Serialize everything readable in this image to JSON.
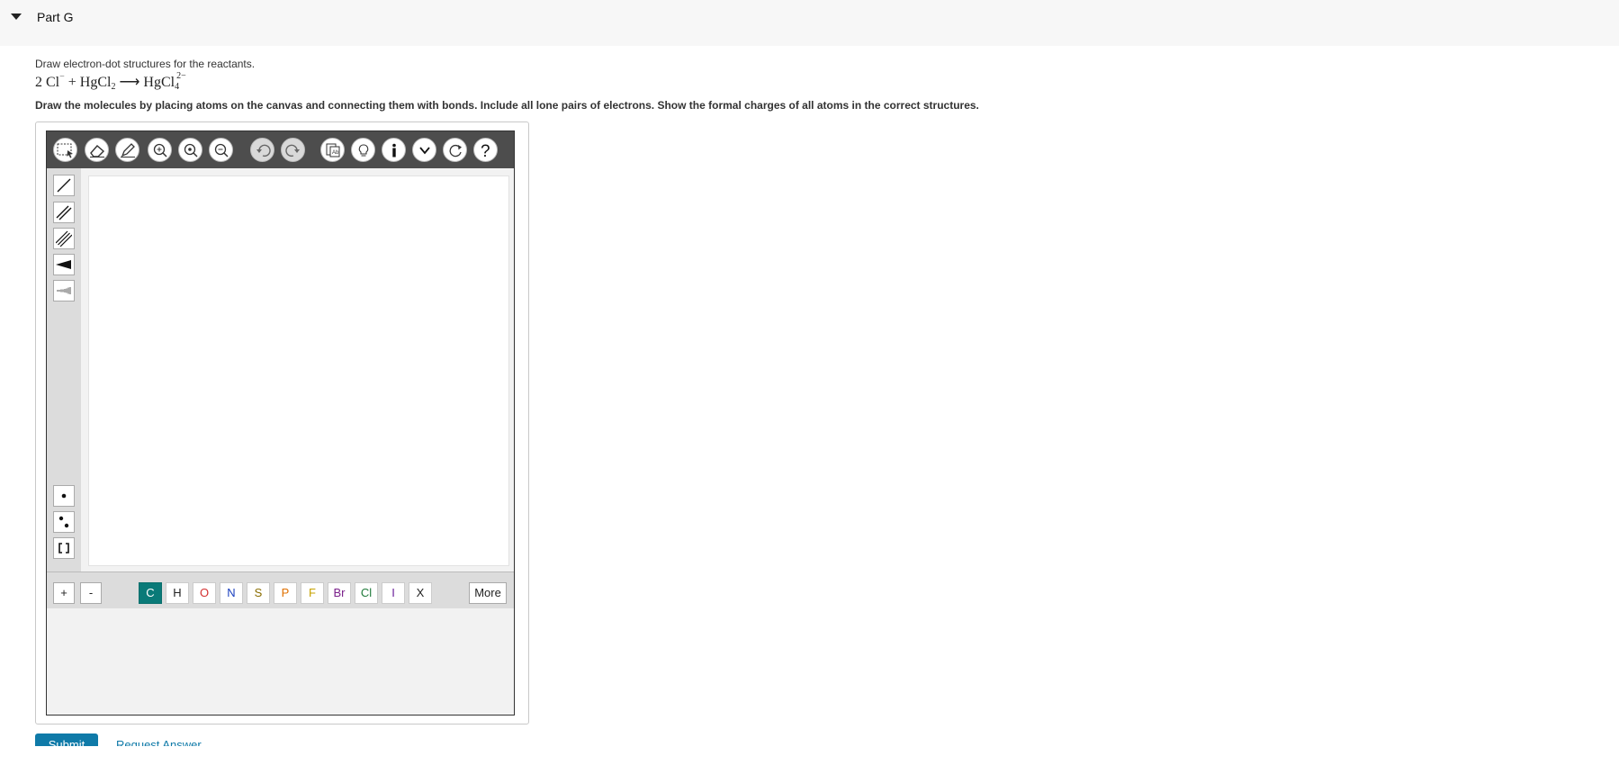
{
  "header": {
    "title": "Part G"
  },
  "question": {
    "prompt": "Draw electron-dot structures for the reactants.",
    "equation": {
      "coef": "2",
      "reactant1": "Cl",
      "reactant1_charge": "−",
      "plus": "+",
      "reactant2": "HgCl",
      "reactant2_sub": "2",
      "arrow": "⟶",
      "product": "HgCl",
      "product_sub": "4",
      "product_charge": "2−"
    },
    "instructions": "Draw the molecules by placing atoms on the canvas and connecting them with bonds. Include all lone pairs of electrons. Show the formal charges of all atoms in the correct structures."
  },
  "editor": {
    "toolbar": [
      "select-icon",
      "eraser-icon",
      "pencil-icon",
      "zoom-in-icon",
      "zoom-fit-icon",
      "zoom-out-icon",
      "undo-icon",
      "redo-icon",
      "template-icon",
      "lightbulb-icon",
      "info-icon",
      "chevron-down-icon",
      "reset-icon",
      "help-icon"
    ],
    "bond_tools": [
      "single-bond-icon",
      "double-bond-icon",
      "triple-bond-icon",
      "wedge-bond-icon",
      "hash-bond-icon"
    ],
    "electron_tools": [
      "single-electron-icon",
      "electron-pair-icon",
      "bracket-icon"
    ],
    "charges": {
      "plus": "+",
      "minus": "-"
    },
    "elements": [
      {
        "symbol": "C",
        "color": "#0a7a78",
        "active": true
      },
      {
        "symbol": "H",
        "color": "#222222",
        "active": false
      },
      {
        "symbol": "O",
        "color": "#d32f2f",
        "active": false
      },
      {
        "symbol": "N",
        "color": "#1a3fbf",
        "active": false
      },
      {
        "symbol": "S",
        "color": "#8a6d00",
        "active": false
      },
      {
        "symbol": "P",
        "color": "#e07000",
        "active": false
      },
      {
        "symbol": "F",
        "color": "#c7a200",
        "active": false
      },
      {
        "symbol": "Br",
        "color": "#7a1f8a",
        "active": false
      },
      {
        "symbol": "Cl",
        "color": "#1f7a3a",
        "active": false
      },
      {
        "symbol": "I",
        "color": "#6a1f9a",
        "active": false
      },
      {
        "symbol": "X",
        "color": "#222222",
        "active": false
      }
    ],
    "more_label": "More"
  },
  "actions": {
    "submit_label": "Submit",
    "request_answer_label": "Request Answer"
  },
  "colors": {
    "accent": "#0f7aa8",
    "toolbar_bg": "#4d4d4d",
    "active_element": "#0a7a78"
  }
}
